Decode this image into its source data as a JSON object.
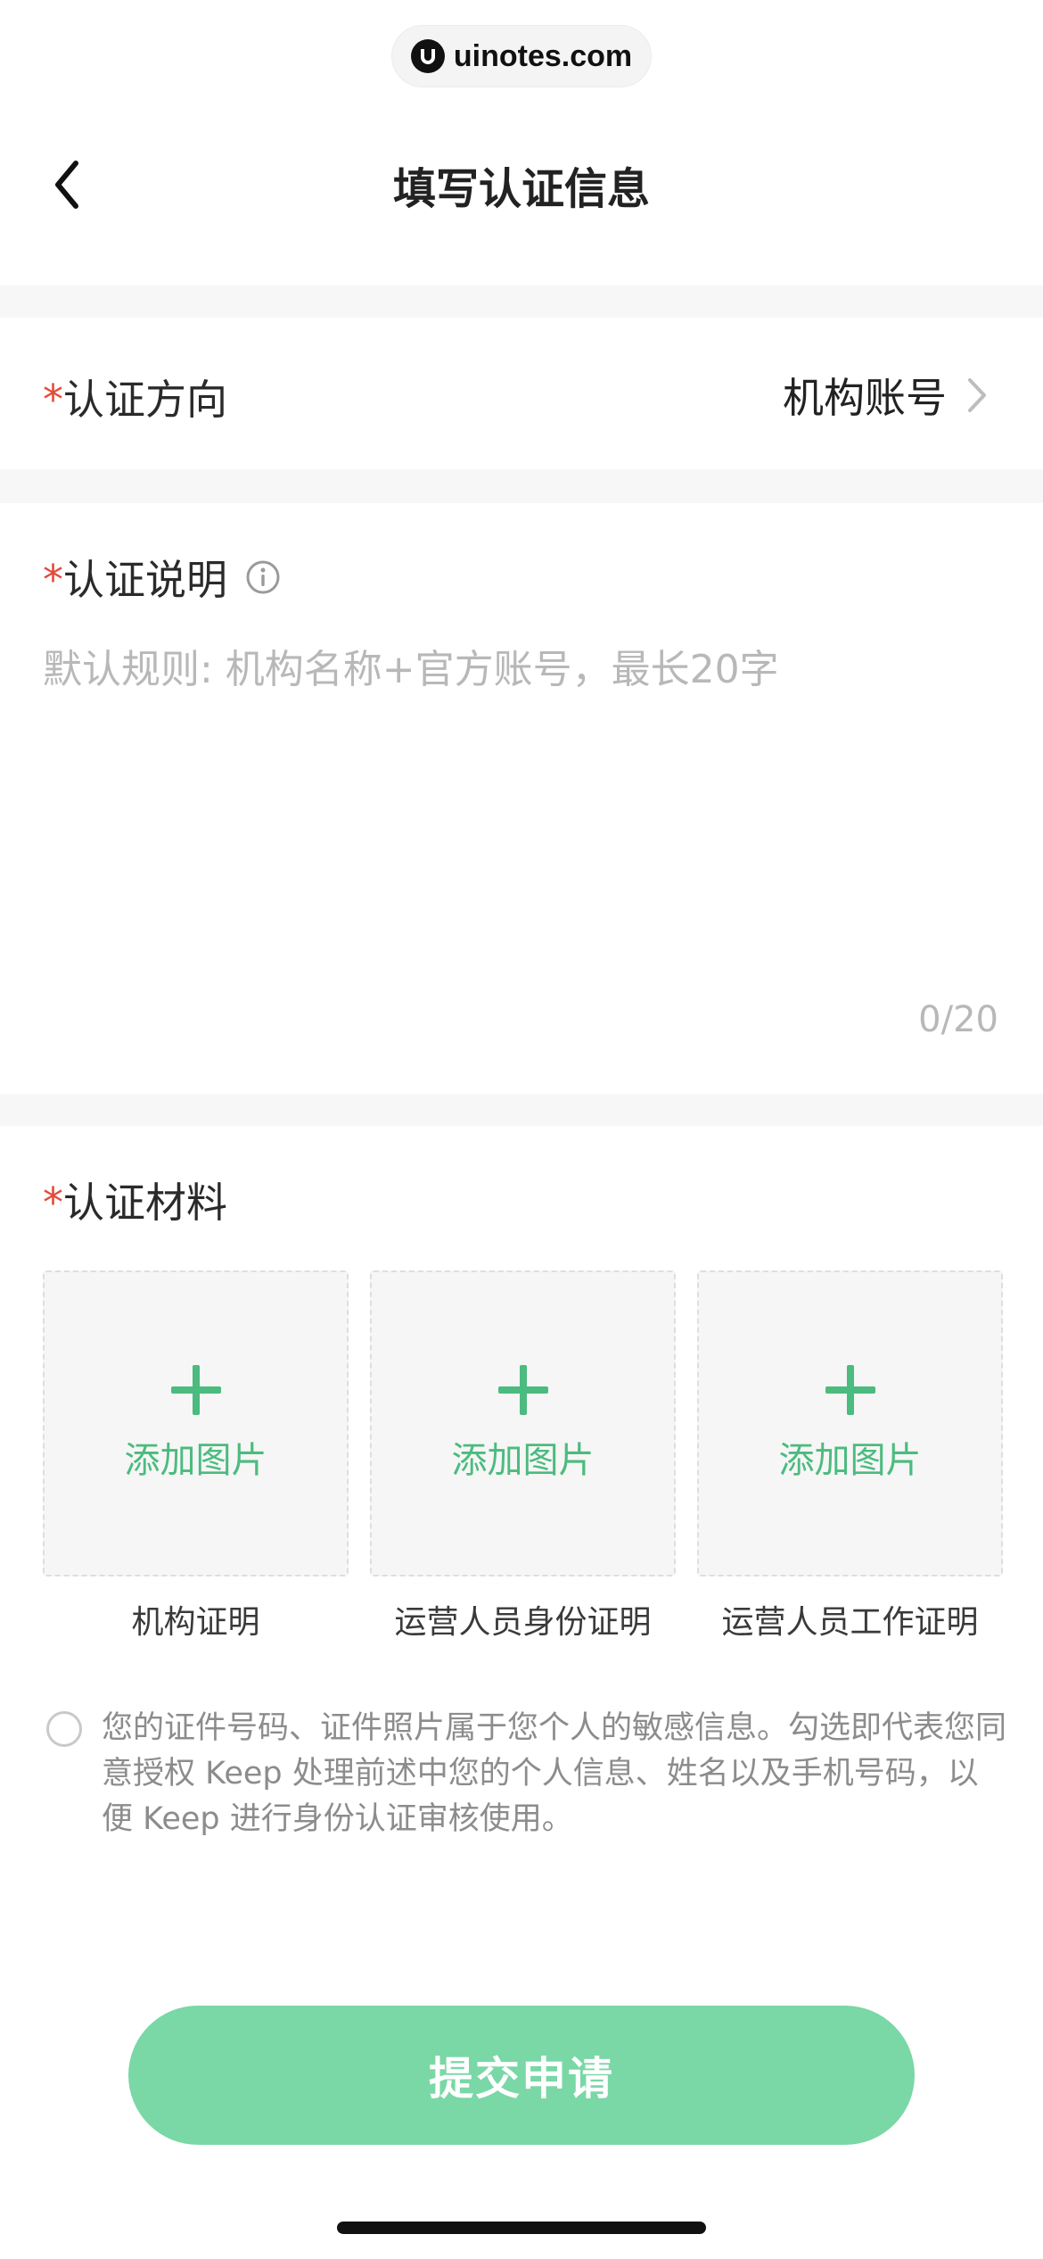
{
  "watermark": {
    "text": "uinotes.com",
    "icon": "uinotes-logo-icon"
  },
  "header": {
    "title": "填写认证信息",
    "back_icon": "chevron-left-icon"
  },
  "direction": {
    "required_mark": "*",
    "label": "认证方向",
    "value": "机构账号",
    "icon": "chevron-right-icon"
  },
  "description": {
    "required_mark": "*",
    "label": "认证说明",
    "info_icon": "info-icon",
    "placeholder": "默认规则: 机构名称+官方账号，最长20字",
    "value": "",
    "counter": "0/20"
  },
  "materials": {
    "required_mark": "*",
    "label": "认证材料",
    "upload_icon": "plus-icon",
    "items": [
      {
        "button_label": "添加图片",
        "caption": "机构证明"
      },
      {
        "button_label": "添加图片",
        "caption": "运营人员身份证明"
      },
      {
        "button_label": "添加图片",
        "caption": "运营人员工作证明"
      }
    ]
  },
  "consent": {
    "checked": false,
    "text": "您的证件号码、证件照片属于您个人的敏感信息。勾选即代表您同意授权 Keep 处理前述中您的个人信息、姓名以及手机号码，以便 Keep 进行身份认证审核使用。"
  },
  "submit": {
    "label": "提交申请",
    "enabled": false
  },
  "colors": {
    "accent": "#4cbb7f",
    "button_disabled": "#7ad7a6",
    "required": "#e24b3a",
    "placeholder": "#b8b8b8"
  }
}
